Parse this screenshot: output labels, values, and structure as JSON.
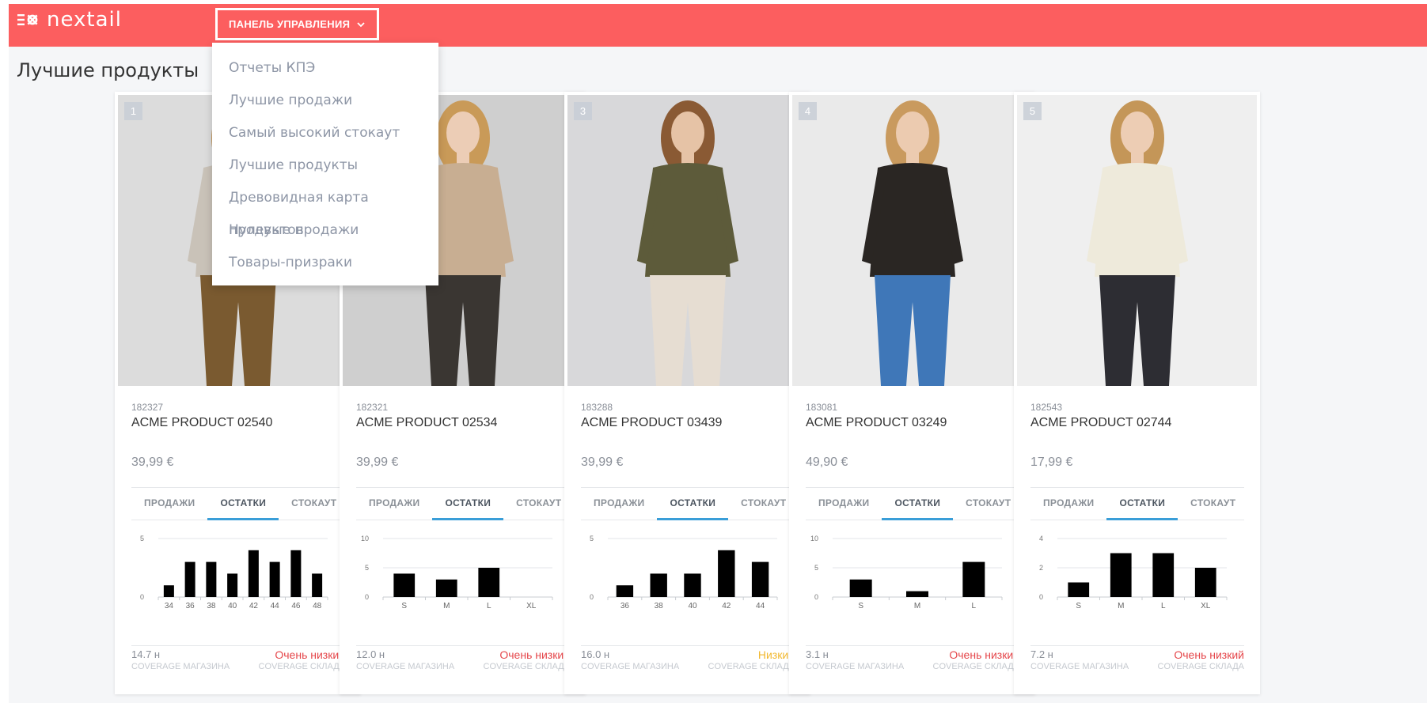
{
  "app": {
    "logo_text": "nextail",
    "nav_button_label": "ПАНЕЛЬ УПРАВЛЕНИЯ",
    "page_title": "Лучшие продукты",
    "colors": {
      "topbar": "#fc5e5f",
      "tab_active": "#3a9ed8",
      "level_very_low": "#e5474b",
      "level_low": "#f2b930"
    }
  },
  "dropdown": {
    "items": [
      "Отчеты КПЭ",
      "Лучшие продажи",
      "Самый высокий стокаут",
      "Лучшие продукты",
      "Древовидная карта продуктов",
      "Нулевые продажи",
      "Товары-призраки"
    ]
  },
  "cards": [
    {
      "rank": "1",
      "sku": "182327",
      "name": "ACME PRODUCT 02540",
      "price": "39,99 €",
      "tabs": [
        "ПРОДАЖИ",
        "ОСТАТКИ",
        "СТОКАУТ"
      ],
      "active_tab": 1,
      "coverage_store": "14.7 н",
      "coverage_level": "Очень низкий",
      "level_color": "#e5474b",
      "coverage_store_label": "COVERAGE МАГАЗИНА",
      "coverage_warehouse_label": "COVERAGE СКЛАДА",
      "photo": {
        "icon": "product-photo-brown-trousers",
        "bg": "#dcdcdc",
        "top": "#c9c2b8",
        "bottom": "#7a5a30",
        "skin": "#e8c4a8",
        "hair": "#c79a5e"
      }
    },
    {
      "rank": "",
      "sku": "182321",
      "name": "ACME PRODUCT 02534",
      "price": "39,99 €",
      "tabs": [
        "ПРОДАЖИ",
        "ОСТАТКИ",
        "СТОКАУТ"
      ],
      "active_tab": 1,
      "coverage_store": "12.0 н",
      "coverage_level": "Очень низкий",
      "level_color": "#e5474b",
      "coverage_store_label": "COVERAGE МАГАЗИНА",
      "coverage_warehouse_label": "COVERAGE СКЛАДА",
      "photo": {
        "icon": "product-photo-beige-sweater",
        "bg": "#cfcfcf",
        "top": "#c8ae92",
        "bottom": "#3a3632",
        "skin": "#eccdb6",
        "hair": "#c99a58"
      }
    },
    {
      "rank": "3",
      "sku": "183288",
      "name": "ACME PRODUCT 03439",
      "price": "39,99 €",
      "tabs": [
        "ПРОДАЖИ",
        "ОСТАТКИ",
        "СТОКАУТ"
      ],
      "active_tab": 1,
      "coverage_store": "16.0 н",
      "coverage_level": "Низкий",
      "level_color": "#f2b930",
      "coverage_store_label": "COVERAGE МАГАЗИНА",
      "coverage_warehouse_label": "COVERAGE СКЛАДА",
      "photo": {
        "icon": "product-photo-cream-trousers",
        "bg": "#d8d8da",
        "top": "#5d5b3a",
        "bottom": "#e6ddd2",
        "skin": "#e6c3a6",
        "hair": "#8a5a34"
      }
    },
    {
      "rank": "4",
      "sku": "183081",
      "name": "ACME PRODUCT 03249",
      "price": "49,90 €",
      "tabs": [
        "ПРОДАЖИ",
        "ОСТАТКИ",
        "СТОКАУТ"
      ],
      "active_tab": 1,
      "coverage_store": "3.1 н",
      "coverage_level": "Очень низкий",
      "level_color": "#e5474b",
      "coverage_store_label": "COVERAGE МАГАЗИНА",
      "coverage_warehouse_label": "COVERAGE СКЛАДА",
      "photo": {
        "icon": "product-photo-black-cardigan",
        "bg": "#eaeaea",
        "top": "#2a2623",
        "bottom": "#3f77b8",
        "skin": "#eccbb0",
        "hair": "#c99a5e"
      }
    },
    {
      "rank": "5",
      "sku": "182543",
      "name": "ACME PRODUCT 02744",
      "price": "17,99 €",
      "tabs": [
        "ПРОДАЖИ",
        "ОСТАТКИ",
        "СТОКАУТ"
      ],
      "active_tab": 1,
      "coverage_store": "7.2 н",
      "coverage_level": "Очень низкий",
      "level_color": "#e5474b",
      "coverage_store_label": "COVERAGE МАГАЗИНА",
      "coverage_warehouse_label": "COVERAGE СКЛАДА",
      "photo": {
        "icon": "product-photo-cream-sweater",
        "bg": "#efefef",
        "top": "#eeeadb",
        "bottom": "#2d2d33",
        "skin": "#edcdb4",
        "hair": "#c49658"
      }
    }
  ],
  "chart_data": [
    {
      "type": "bar",
      "categories": [
        "34",
        "36",
        "38",
        "40",
        "42",
        "44",
        "46",
        "48"
      ],
      "values": [
        1,
        3,
        3,
        2,
        4,
        3,
        4,
        2
      ],
      "ylim": [
        0,
        5
      ],
      "yticks": [
        0,
        5
      ]
    },
    {
      "type": "bar",
      "categories": [
        "S",
        "M",
        "L",
        "XL"
      ],
      "values": [
        4,
        3,
        5,
        0
      ],
      "ylim": [
        0,
        10
      ],
      "yticks": [
        0,
        5,
        10
      ]
    },
    {
      "type": "bar",
      "categories": [
        "36",
        "38",
        "40",
        "42",
        "44"
      ],
      "values": [
        1,
        2,
        2,
        4,
        3
      ],
      "ylim": [
        0,
        5
      ],
      "yticks": [
        0,
        5
      ]
    },
    {
      "type": "bar",
      "categories": [
        "S",
        "M",
        "L"
      ],
      "values": [
        3,
        1,
        6
      ],
      "ylim": [
        0,
        10
      ],
      "yticks": [
        0,
        5,
        10
      ]
    },
    {
      "type": "bar",
      "categories": [
        "S",
        "M",
        "L",
        "XL"
      ],
      "values": [
        1,
        3,
        3,
        2
      ],
      "ylim": [
        0,
        4
      ],
      "yticks": [
        0,
        2,
        4
      ]
    }
  ]
}
